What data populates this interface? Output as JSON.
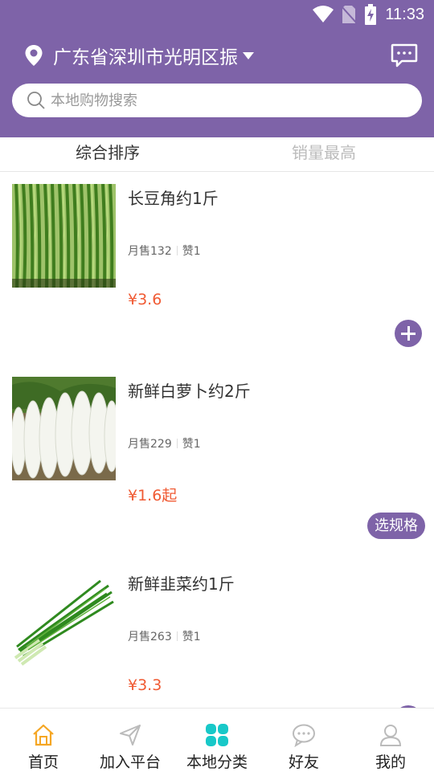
{
  "status_bar": {
    "time": "11:33"
  },
  "header": {
    "location": "广东省深圳市光明区振",
    "search_placeholder": "本地购物搜索"
  },
  "tabs": [
    {
      "label": "综合排序",
      "active": true
    },
    {
      "label": "销量最高",
      "active": false
    }
  ],
  "products": [
    {
      "name": "长豆角约1斤",
      "sales": "月售132",
      "likes": "赞1",
      "price": "¥3.6",
      "action": "add"
    },
    {
      "name": "新鲜白萝卜约2斤",
      "sales": "月售229",
      "likes": "赞1",
      "price": "¥1.6起",
      "action": "选规格"
    },
    {
      "name": "新鲜韭菜约1斤",
      "sales": "月售263",
      "likes": "赞1",
      "price": "¥3.3",
      "action": "add"
    }
  ],
  "bottom_nav": [
    {
      "label": "首页",
      "icon": "home-icon",
      "color": "#f5a623"
    },
    {
      "label": "加入平台",
      "icon": "send-icon",
      "color": "#bbbbbb"
    },
    {
      "label": "本地分类",
      "icon": "category-icon",
      "color": "#18c8c8"
    },
    {
      "label": "好友",
      "icon": "chat-bubble-icon",
      "color": "#bbbbbb"
    },
    {
      "label": "我的",
      "icon": "user-icon",
      "color": "#bbbbbb"
    }
  ],
  "colors": {
    "brand": "#7e63a8",
    "price": "#f05a33"
  }
}
